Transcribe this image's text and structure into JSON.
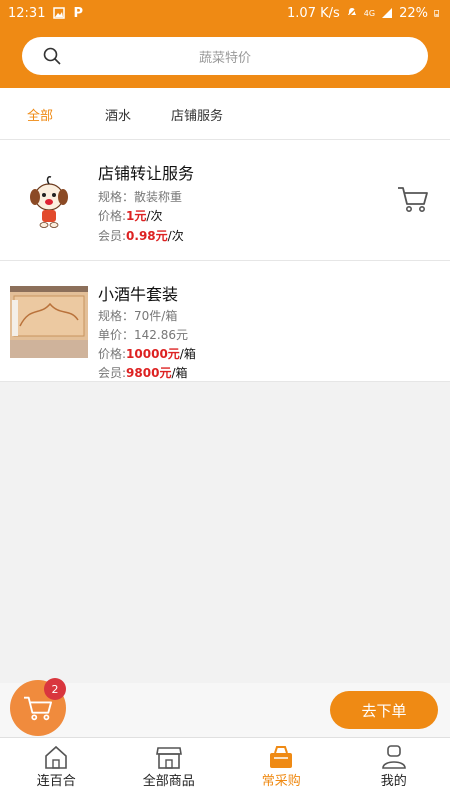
{
  "status": {
    "time": "12:31",
    "net": "1.07 K/s",
    "battery": "22%",
    "signal": "4G"
  },
  "search": {
    "placeholder": "蔬菜特价"
  },
  "tabs": [
    {
      "label": "全部",
      "active": true
    },
    {
      "label": "酒水",
      "active": false
    },
    {
      "label": "店铺服务",
      "active": false
    }
  ],
  "items": [
    {
      "title": "店铺转让服务",
      "spec_label": "规格：",
      "spec": "散装称重",
      "price_label": "价格:",
      "price": "1元",
      "price_unit": "/次",
      "member_label": "会员:",
      "member_price": "0.98元",
      "member_unit": "/次"
    },
    {
      "title": "小酒牛套装",
      "spec_label": "规格：",
      "spec": "70件/箱",
      "unit_label": "单价：",
      "unit_price": "142.86元",
      "price_label": "价格:",
      "price": "10000元",
      "price_unit": "/箱",
      "member_label": "会员:",
      "member_price": "9800元",
      "member_unit": "/箱"
    }
  ],
  "cart": {
    "count": "2"
  },
  "order_button": "去下单",
  "bottom_nav": [
    {
      "label": "连百合",
      "icon": "home-icon"
    },
    {
      "label": "全部商品",
      "icon": "store-icon"
    },
    {
      "label": "常采购",
      "icon": "basket-icon",
      "active": true
    },
    {
      "label": "我的",
      "icon": "user-icon"
    }
  ],
  "colors": {
    "brand": "#ef8a14",
    "price": "#d22",
    "badge": "#d9363e"
  }
}
